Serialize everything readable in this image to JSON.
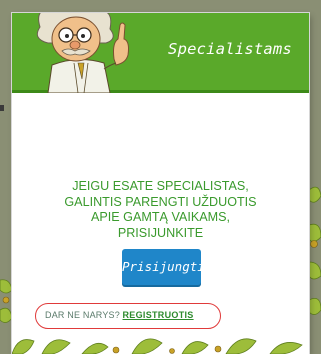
{
  "header": {
    "title": "Specialistams"
  },
  "mascot": {
    "icon": "scientist-mascot-icon"
  },
  "message": {
    "lines": [
      "JEIGU ESATE SPECIALISTAS,",
      "GALINTIS PARENGTI UŽDUOTIS",
      "APIE GAMTĄ VAIKAMS,",
      "PRISIJUNKITE"
    ]
  },
  "login": {
    "label": "Prisijungti"
  },
  "register": {
    "prompt": "DAR NE NARYS?",
    "link_label": "REGISTRUOTIS"
  },
  "colors": {
    "header_green": "#5aa92a",
    "message_green": "#3a9a2d",
    "button_blue": "#1f86c9",
    "highlight_red": "#e03a3a",
    "backdrop": "#8a8f74"
  }
}
